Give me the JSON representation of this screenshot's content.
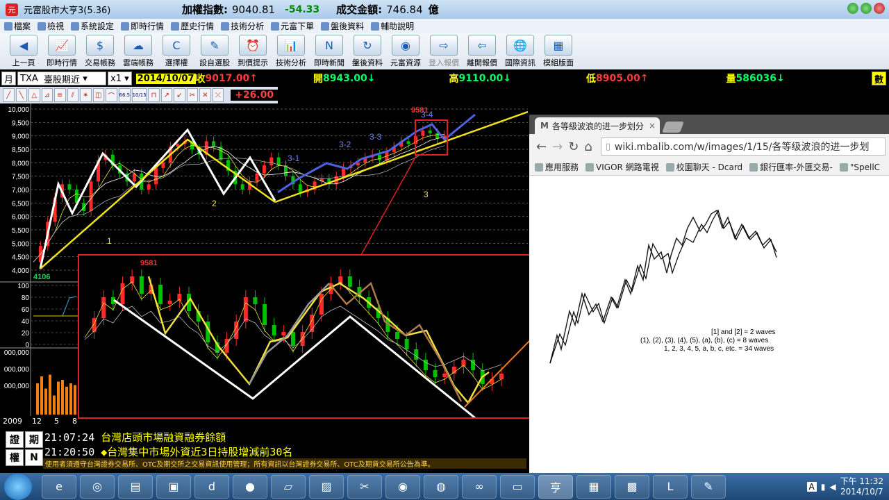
{
  "titlebar": {
    "app_title": "元富股市大亨3(5.36)",
    "index_label": "加權指數:",
    "index_value": "9040.81",
    "index_change": "-54.33",
    "volume_label": "成交金額:",
    "volume_value": "746.84",
    "volume_unit": "億"
  },
  "menu": [
    "檔案",
    "檢視",
    "系統設定",
    "即時行情",
    "歷史行情",
    "技術分析",
    "元富下單",
    "盤後資料",
    "輔助說明"
  ],
  "toolbar": [
    {
      "label": "上一頁",
      "icon": "back-arrow-icon",
      "glyph": "◀"
    },
    {
      "label": "即時行情",
      "icon": "realtime-chart-icon",
      "glyph": "📈"
    },
    {
      "label": "交易帳務",
      "icon": "trading-account-icon",
      "glyph": "$"
    },
    {
      "label": "雲端帳務",
      "icon": "cloud-account-icon",
      "glyph": "☁"
    },
    {
      "label": "選擇權",
      "icon": "options-icon",
      "glyph": "C"
    },
    {
      "label": "設自選股",
      "icon": "watchlist-icon",
      "glyph": "✎"
    },
    {
      "label": "到價提示",
      "icon": "price-alert-icon",
      "glyph": "⏰"
    },
    {
      "label": "技術分析",
      "icon": "technical-analysis-icon",
      "glyph": "📊"
    },
    {
      "label": "即時新聞",
      "icon": "news-icon",
      "glyph": "N"
    },
    {
      "label": "盤後資料",
      "icon": "after-hours-icon",
      "glyph": "↻"
    },
    {
      "label": "元富資源",
      "icon": "masterlink-resource-icon",
      "glyph": "◉"
    },
    {
      "label": "登入報價",
      "icon": "login-quote-icon",
      "glyph": "⇨"
    },
    {
      "label": "離開報價",
      "icon": "logout-quote-icon",
      "glyph": "⇦"
    },
    {
      "label": "國際資訊",
      "icon": "globe-icon",
      "glyph": "🌐"
    },
    {
      "label": "模組版面",
      "icon": "layout-module-icon",
      "glyph": "▦"
    }
  ],
  "quote": {
    "period": "月",
    "symbol": "TXA",
    "name": "臺股期近",
    "multiplier": "x1",
    "date": "2014/10/07",
    "close_label": "收",
    "close_value": "9017.00",
    "open_label": "開",
    "open_value": "8943.00",
    "high_label": "高",
    "high_value": "9110.00",
    "low_label": "低",
    "low_value": "8905.00",
    "vol_label": "量",
    "vol_value": "586036",
    "unit_label": "數",
    "change": "+26.00",
    "up_arrow": "↑",
    "down_arrow": "↓",
    "dropdown_arrow": "▾"
  },
  "drawtools": [
    "╱",
    "╲",
    "△",
    "⊿",
    "≡",
    "⫽",
    "✶",
    "◫",
    "⌒",
    "⊓",
    "↗",
    "↙",
    "✂",
    "✕",
    "⤫"
  ],
  "drawtool_labels": [
    "66.5",
    "10/15"
  ],
  "chart_labels": {
    "price_ticks": [
      "10,000",
      "9,500",
      "9,000",
      "8,500",
      "8,000",
      "7,500",
      "7,000",
      "6,500",
      "6,000",
      "5,500",
      "5,000",
      "4,500",
      "4,000"
    ],
    "ind_ticks": [
      "100",
      "80",
      "60",
      "40",
      "20",
      "0"
    ],
    "vol_ticks": [
      "000,000",
      "000,000",
      "000,000"
    ],
    "low_label": "4106",
    "high_label": "9581",
    "wave_labels": [
      "1",
      "2",
      "3",
      "3-1",
      "3-2",
      "3-3",
      "3-4"
    ],
    "inset_high": "9581",
    "time_labels": [
      "2009",
      "12",
      "5",
      "8"
    ]
  },
  "news": {
    "tag1": "證",
    "tag2": "期",
    "tag3": "權",
    "tag4": "N",
    "items": [
      {
        "time": "21:07:24",
        "text": "台灣店頭市場融資融券餘額"
      },
      {
        "time": "21:20:50",
        "text": "◆台灣集中市場外資近3日持股增減前30名"
      }
    ],
    "disclaimer": "使用者須遵守台灣證券交易所、OTC及期交所之交易資訊使用管理；所有資訊以台灣證券交易所、OTC及期貨交易所公告為準。"
  },
  "browser": {
    "tab_title": "各等級波浪的进一步划分",
    "tab_close": "×",
    "url": "wiki.mbalib.com/w/images/1/15/各等级波浪的进一步划",
    "bookmarks": [
      "應用服務",
      "VIGOR 網路電視",
      "校園聊天 - Dcard",
      "銀行匯率-外匯交易-",
      "\"SpellC"
    ],
    "legend": [
      "[1] and [2] = 2 waves",
      "(1), (2), (3), (4), (5), (a), (b), (c) = 8 waves",
      "1, 2, 3, 4, 5, a, b, c, etc. = 34 waves"
    ]
  },
  "taskbar": {
    "clock_time": "下午 11:32",
    "clock_date": "2014/10/7",
    "lang": "A"
  },
  "colors": {
    "up": "#ff2a2a",
    "down": "#00c000",
    "yellow_trend": "#f2e21a",
    "white_wave": "#ffffff",
    "blue_wave": "#4f62e0",
    "red_frame": "#e02020",
    "orange_line": "#f07a1a"
  }
}
